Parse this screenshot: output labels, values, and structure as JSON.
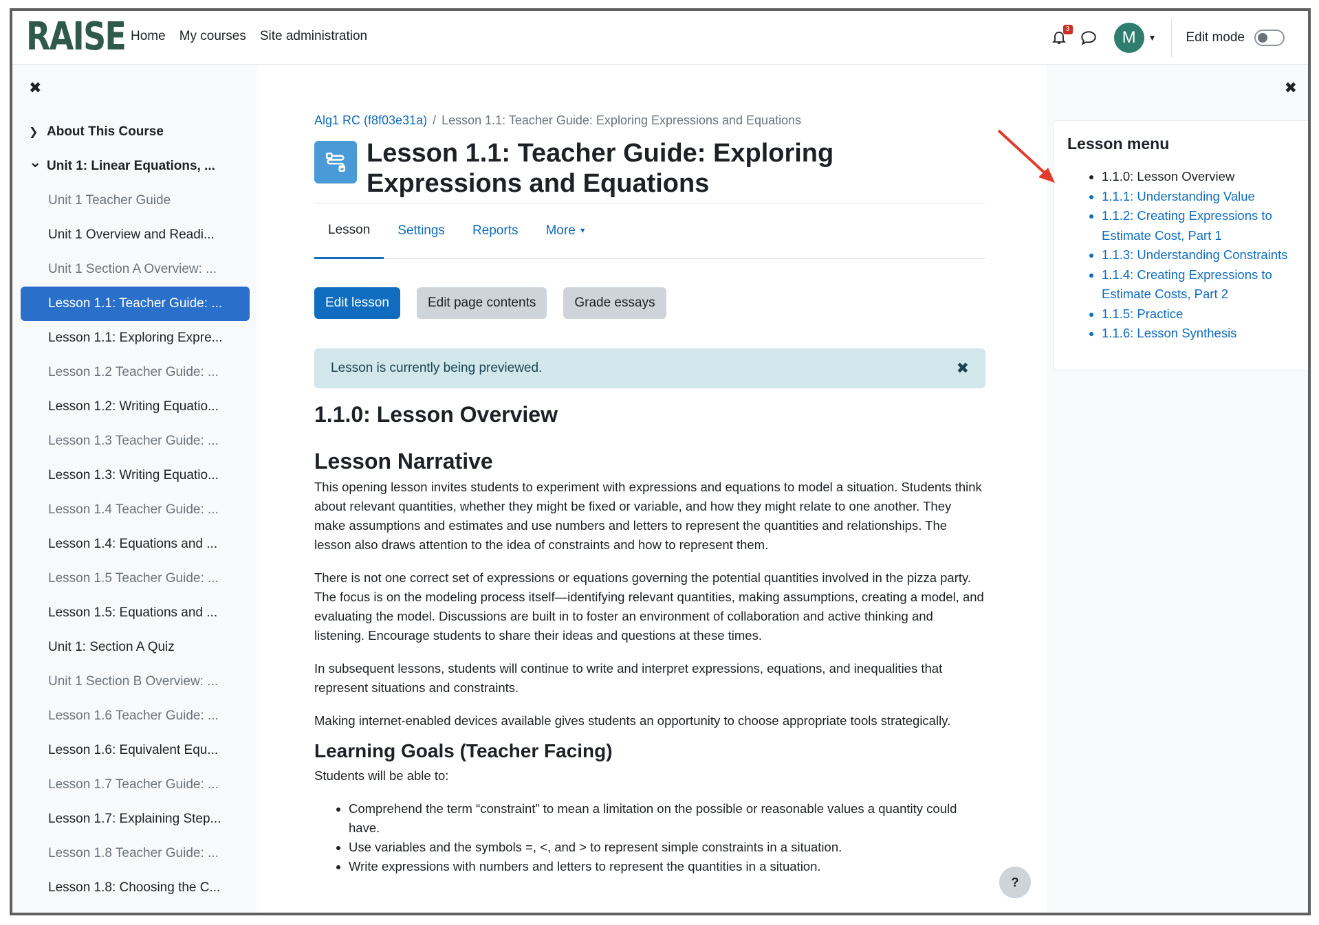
{
  "navbar": {
    "logo": "RAISE",
    "links": [
      "Home",
      "My courses",
      "Site administration"
    ],
    "notification_count": "3",
    "avatar_initial": "M",
    "edit_mode_label": "Edit mode",
    "edit_mode_on": false
  },
  "course_index": {
    "items": [
      {
        "type": "section",
        "label": "About This Course",
        "expanded": false
      },
      {
        "type": "section",
        "label": "Unit 1: Linear Equations, ...",
        "expanded": true
      },
      {
        "type": "item",
        "label": "Unit 1 Teacher Guide",
        "dim": true
      },
      {
        "type": "item",
        "label": "Unit 1 Overview and Readi...",
        "dim": false
      },
      {
        "type": "item",
        "label": "Unit 1 Section A Overview: ...",
        "dim": true
      },
      {
        "type": "item",
        "label": "Lesson 1.1: Teacher Guide: ...",
        "active": true
      },
      {
        "type": "item",
        "label": "Lesson 1.1: Exploring Expre...",
        "dim": false
      },
      {
        "type": "item",
        "label": "Lesson 1.2 Teacher Guide: ...",
        "dim": true
      },
      {
        "type": "item",
        "label": "Lesson 1.2: Writing Equatio...",
        "dim": false
      },
      {
        "type": "item",
        "label": "Lesson 1.3 Teacher Guide: ...",
        "dim": true
      },
      {
        "type": "item",
        "label": "Lesson 1.3: Writing Equatio...",
        "dim": false
      },
      {
        "type": "item",
        "label": "Lesson 1.4 Teacher Guide: ...",
        "dim": true
      },
      {
        "type": "item",
        "label": "Lesson 1.4: Equations and ...",
        "dim": false
      },
      {
        "type": "item",
        "label": "Lesson 1.5 Teacher Guide: ...",
        "dim": true
      },
      {
        "type": "item",
        "label": "Lesson 1.5: Equations and ...",
        "dim": false
      },
      {
        "type": "item",
        "label": "Unit 1: Section A Quiz",
        "dim": false
      },
      {
        "type": "item",
        "label": "Unit 1 Section B Overview: ...",
        "dim": true
      },
      {
        "type": "item",
        "label": "Lesson 1.6 Teacher Guide: ...",
        "dim": true
      },
      {
        "type": "item",
        "label": "Lesson 1.6: Equivalent Equ...",
        "dim": false
      },
      {
        "type": "item",
        "label": "Lesson 1.7 Teacher Guide: ...",
        "dim": true
      },
      {
        "type": "item",
        "label": "Lesson 1.7: Explaining Step...",
        "dim": false
      },
      {
        "type": "item",
        "label": "Lesson 1.8 Teacher Guide: ...",
        "dim": true
      },
      {
        "type": "item",
        "label": "Lesson 1.8: Choosing the C...",
        "dim": false
      }
    ]
  },
  "main": {
    "breadcrumb": {
      "course": "Alg1 RC (f8f03e31a)",
      "separator": "/",
      "current": "Lesson 1.1: Teacher Guide: Exploring Expressions and Equations"
    },
    "title": "Lesson 1.1: Teacher Guide: Exploring Expressions and Equations",
    "tabs": [
      "Lesson",
      "Settings",
      "Reports",
      "More"
    ],
    "buttons": {
      "edit_lesson": "Edit lesson",
      "edit_page_contents": "Edit page contents",
      "grade_essays": "Grade essays"
    },
    "alert": "Lesson is currently being previewed.",
    "content": {
      "page_heading": "1.1.0: Lesson Overview",
      "narrative_heading": "Lesson Narrative",
      "paragraphs": [
        "This opening lesson invites students to experiment with expressions and equations to model a situation. Students think about relevant quantities, whether they might be fixed or variable, and how they might relate to one another. They make assumptions and estimates and use numbers and letters to represent the quantities and relationships. The lesson also draws attention to the idea of constraints and how to represent them.",
        "There is not one correct set of expressions or equations governing the potential quantities involved in the pizza party. The focus is on the modeling process itself—identifying relevant quantities, making assumptions, creating a model, and evaluating the model. Discussions are built in to foster an environment of collaboration and active thinking and listening. Encourage students to share their ideas and questions at these times.",
        "In subsequent lessons, students will continue to write and interpret expressions, equations, and inequalities that represent situations and constraints.",
        "Making internet-enabled devices available gives students an opportunity to choose appropriate tools strategically."
      ],
      "goals_heading": "Learning Goals (Teacher Facing)",
      "goals_intro": "Students will be able to:",
      "goals": [
        "Comprehend the term “constraint” to mean a limitation on the possible or reasonable values a quantity could have.",
        "Use variables and the symbols =, <, and > to represent simple constraints in a situation.",
        "Write expressions with numbers and letters to represent the quantities in a situation."
      ]
    },
    "help_label": "?"
  },
  "lesson_menu": {
    "title": "Lesson menu",
    "items": [
      {
        "label": "1.1.0: Lesson Overview",
        "current": true
      },
      {
        "label": "1.1.1: Understanding Value",
        "current": false
      },
      {
        "label": "1.1.2: Creating Expressions to Estimate Cost, Part 1",
        "current": false
      },
      {
        "label": "1.1.3: Understanding Constraints",
        "current": false
      },
      {
        "label": "1.1.4: Creating Expressions to Estimate Costs, Part 2",
        "current": false
      },
      {
        "label": "1.1.5: Practice",
        "current": false
      },
      {
        "label": "1.1.6: Lesson Synthesis",
        "current": false
      }
    ]
  },
  "colors": {
    "accent": "#0f6cbf",
    "logo": "#2f5a4b",
    "alert_bg": "#d1e7ec",
    "annotation_arrow": "#e23b2e"
  }
}
